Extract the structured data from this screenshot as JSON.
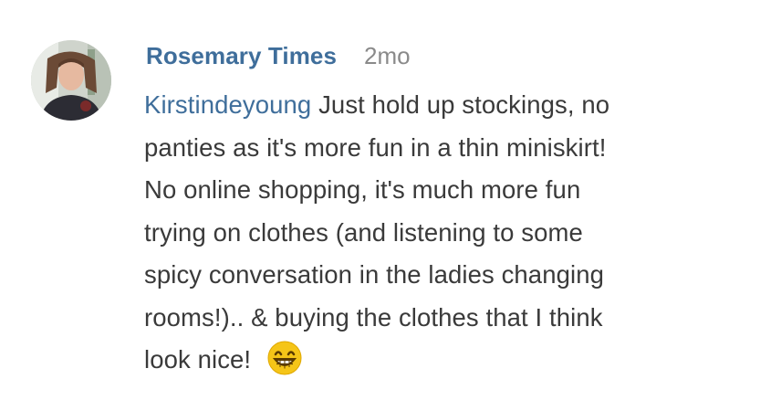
{
  "comment": {
    "author": "Rosemary Times",
    "time_ago": "2mo",
    "mention": "Kirstindeyoung",
    "lines": [
      " Just hold up stockings, no",
      "panties as it's more fun in a thin miniskirt!",
      "No online shopping, it's much more fun",
      "trying on clothes (and listening to some",
      "spicy conversation in the ladies changing",
      "rooms!).. & buying the clothes that I think",
      "look nice! "
    ],
    "emoji_icon": "grinning-face-with-smiling-eyes-icon",
    "avatar_icon": "user-avatar"
  },
  "colors": {
    "link": "#3f6e9b",
    "text": "#3a3a3a",
    "muted": "#8a8a8a",
    "emoji": "#f5c518"
  }
}
